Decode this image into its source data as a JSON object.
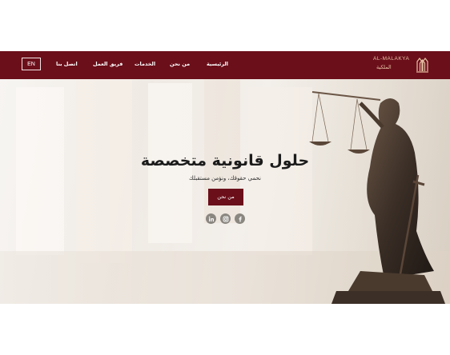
{
  "header": {
    "lang_button": "EN",
    "nav": [
      "اتصل بنا",
      "فريق العمل",
      "الخدمات",
      "من نحن",
      "الرئيسية"
    ],
    "logo_en": "AL-MALAKYA",
    "logo_ar": "الملكية"
  },
  "hero": {
    "title": "حلول قانونية متخصصة",
    "subtitle": "نحمي حقوقك، ونؤمن مستقبلك",
    "cta_label": "من نحن",
    "social_icons": [
      "facebook-icon",
      "instagram-icon",
      "linkedin-icon"
    ]
  },
  "colors": {
    "brand": "#6b0f1a",
    "accent": "#e7c3a5"
  }
}
